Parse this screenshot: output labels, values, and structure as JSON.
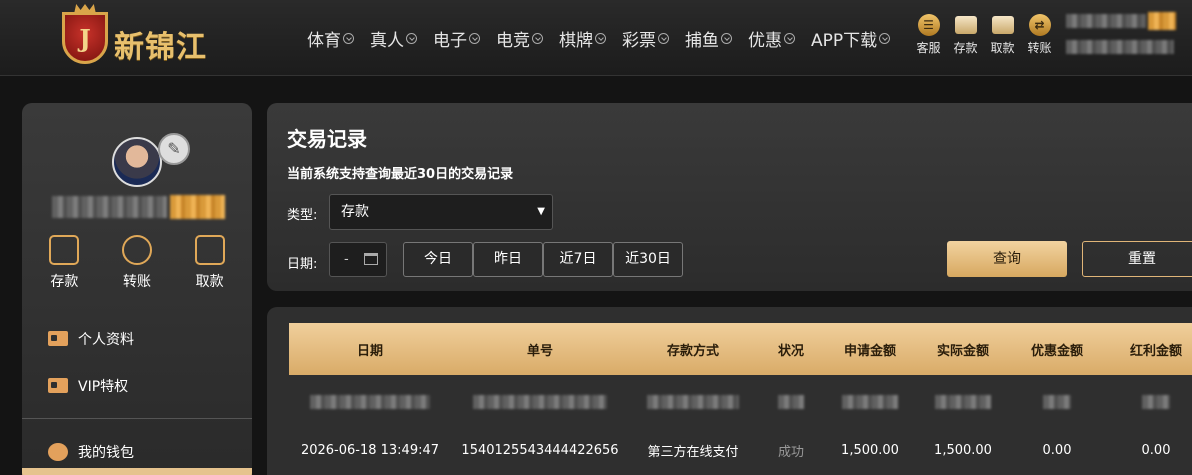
{
  "header": {
    "logo_text": "新锦江",
    "logo_letter": "J",
    "nav": [
      "体育",
      "真人",
      "电子",
      "电竞",
      "棋牌",
      "彩票",
      "捕鱼",
      "优惠",
      "APP下载"
    ],
    "quick": [
      {
        "label": "客服",
        "icon": "service-icon"
      },
      {
        "label": "存款",
        "icon": "wallet-icon"
      },
      {
        "label": "取款",
        "icon": "card-icon"
      },
      {
        "label": "转账",
        "icon": "transfer-icon"
      }
    ]
  },
  "sidebar": {
    "wallet_actions": [
      {
        "label": "存款",
        "icon": "wallet-icon"
      },
      {
        "label": "转账",
        "icon": "transfer-icon"
      },
      {
        "label": "取款",
        "icon": "card-icon"
      }
    ],
    "menu": [
      {
        "label": "个人资料",
        "icon": "profile-card-icon"
      },
      {
        "label": "VIP特权",
        "icon": "vip-card-icon"
      },
      {
        "label": "我的钱包",
        "icon": "piggy-bank-icon"
      }
    ]
  },
  "query": {
    "title": "交易记录",
    "note": "当前系统支持查询最近30日的交易记录",
    "type_label": "类型:",
    "type_value": "存款",
    "date_label": "日期:",
    "date_value": "-",
    "ranges": [
      "今日",
      "昨日",
      "近7日",
      "近30日"
    ],
    "query_button": "查询",
    "reset_button": "重置"
  },
  "table": {
    "headers": [
      "日期",
      "单号",
      "存款方式",
      "状况",
      "申请金额",
      "实际金额",
      "优惠金额",
      "红利金额"
    ],
    "rows": [
      [
        "2026-06-18 13:49:47",
        "1540125543444422656",
        "第三方在线支付",
        "成功",
        "1,500.00",
        "1,500.00",
        "0.00",
        "0.00"
      ]
    ]
  },
  "colors": {
    "accent_gold": "#e0a858",
    "header_gold": "#f0cf9c",
    "panel_bg": "#3a3a3a",
    "page_bg": "#141414"
  }
}
